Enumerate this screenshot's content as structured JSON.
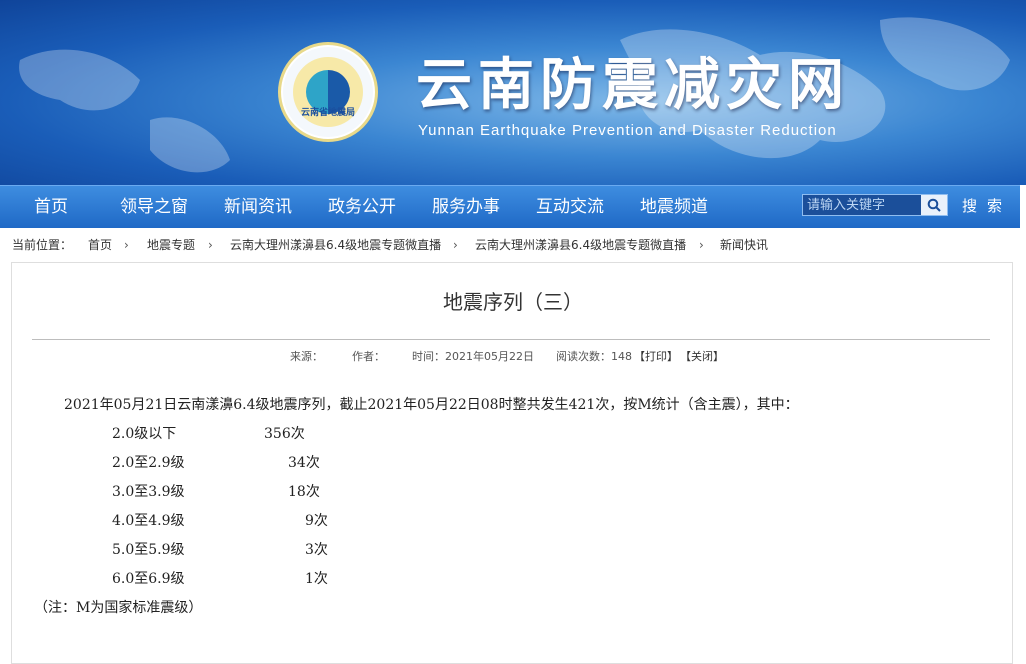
{
  "site": {
    "title": "云南防震减灾网",
    "subtitle": "Yunnan Earthquake Prevention and Disaster Reduction",
    "logo_text": "云南省地震局"
  },
  "nav": {
    "items": [
      "首页",
      "领导之窗",
      "新闻资讯",
      "政务公开",
      "服务办事",
      "互动交流",
      "地震频道"
    ],
    "search_placeholder": "请输入关键字",
    "search_label": "搜索"
  },
  "breadcrumb": {
    "prefix": "当前位置：",
    "items": [
      "首页",
      "地震专题",
      "云南大理州漾濞县6.4级地震专题微直播",
      "云南大理州漾濞县6.4级地震专题微直播",
      "新闻快讯"
    ]
  },
  "article": {
    "title": "地震序列（三）",
    "meta": {
      "source": "来源：",
      "author": "作者：",
      "time": "时间：2021年05月22日",
      "reads": "阅读次数：148",
      "print": "【打印】",
      "close": "【关闭】"
    },
    "intro": "2021年05月21日云南漾濞6.4级地震序列，截止2021年05月22日08时整共发生421次，按M统计（含主震），其中：",
    "rows": [
      {
        "range": "2.0级以下",
        "count": "356次"
      },
      {
        "range": "2.0至2.9级",
        "count": "34次"
      },
      {
        "range": "3.0至3.9级",
        "count": "18次"
      },
      {
        "range": "4.0至4.9级",
        "count": "9次"
      },
      {
        "range": "5.0至5.9级",
        "count": "3次"
      },
      {
        "range": "6.0至6.9级",
        "count": "1次"
      }
    ],
    "note": "（注：M为国家标准震级）"
  }
}
